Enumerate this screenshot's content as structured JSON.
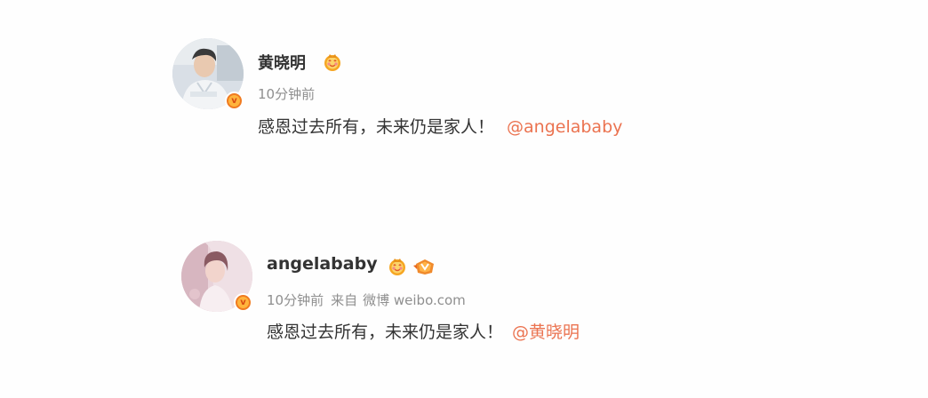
{
  "posts": [
    {
      "author": "黄晓明",
      "time": "10分钟前",
      "source_prefix": "",
      "source": "",
      "text": "感恩过去所有，未来仍是家人！",
      "mention": "@angelababy",
      "badges": [
        "vip-crown-icon"
      ]
    },
    {
      "author": "angelababy",
      "time": "10分钟前",
      "source_prefix": "来自",
      "source": "微博 weibo.com",
      "text": "感恩过去所有，未来仍是家人！",
      "mention": "@黄晓明",
      "badges": [
        "vip-crown-icon",
        "membership-badge-icon"
      ]
    }
  ],
  "colors": {
    "mention": "#eb7350",
    "name": "#333333",
    "meta": "#8f8f8f",
    "verified_badge": "#f07b21"
  }
}
